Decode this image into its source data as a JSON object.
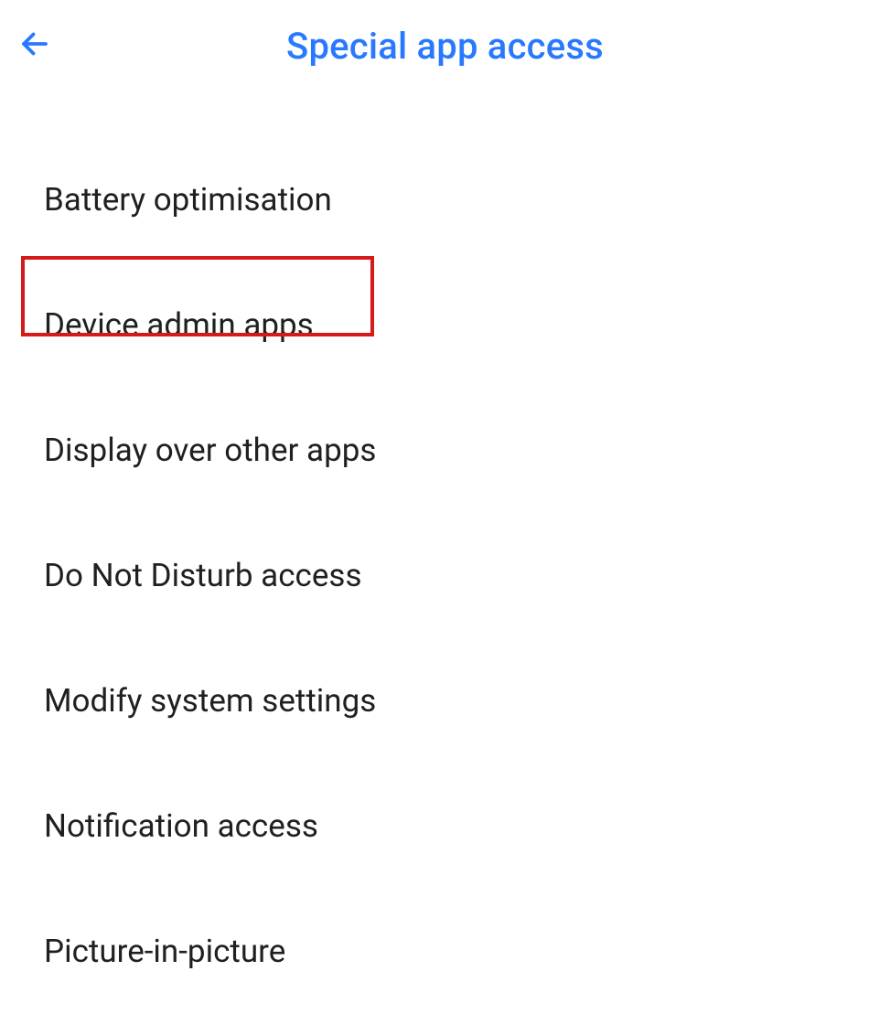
{
  "header": {
    "title": "Special app access"
  },
  "items": [
    {
      "label": "Battery optimisation"
    },
    {
      "label": "Device admin apps"
    },
    {
      "label": "Display over other apps"
    },
    {
      "label": "Do Not Disturb access"
    },
    {
      "label": "Modify system settings"
    },
    {
      "label": "Notification access"
    },
    {
      "label": "Picture-in-picture"
    }
  ],
  "highlight": {
    "index": 1
  }
}
